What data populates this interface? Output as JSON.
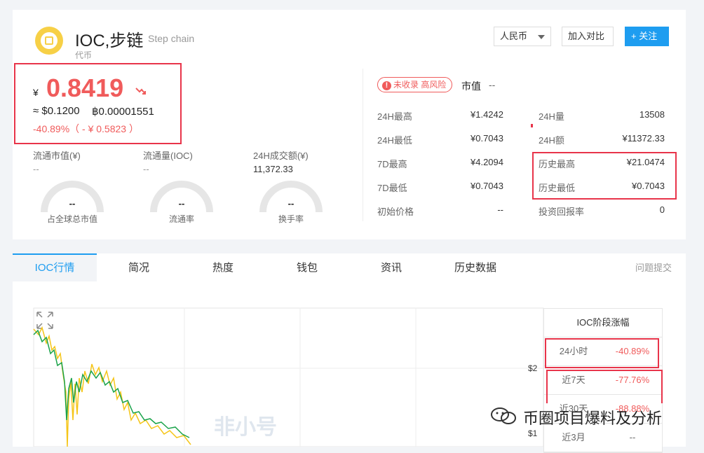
{
  "coin": {
    "name": "IOC,步链",
    "english_name": "Step chain",
    "type": "代币"
  },
  "header_buttons": {
    "currency": "人民币",
    "compare": "加入对比",
    "follow": "+ 关注"
  },
  "price": {
    "symbol": "¥",
    "value": "0.8419",
    "usd": "≈ $0.1200",
    "btc": "฿0.00001551",
    "change": "-40.89%（ - ¥ 0.5823 ）"
  },
  "stats": [
    {
      "label": "流通市值(¥)",
      "value": "--"
    },
    {
      "label": "流通量(IOC)",
      "value": "--"
    },
    {
      "label": "24H成交额(¥)",
      "value": "11,372.33"
    }
  ],
  "gauges": [
    {
      "value": "--",
      "label": "占全球总市值"
    },
    {
      "value": "--",
      "label": "流通率"
    },
    {
      "value": "--",
      "label": "换手率"
    }
  ],
  "risk_badge": "未收录 高风险",
  "market_cap": {
    "label": "市值",
    "value": "--"
  },
  "metrics_left": [
    {
      "label": "24H最高",
      "value": "¥1.4242"
    },
    {
      "label": "24H最低",
      "value": "¥0.7043"
    },
    {
      "label": "7D最高",
      "value": "¥4.2094"
    },
    {
      "label": "7D最低",
      "value": "¥0.7043"
    },
    {
      "label": "初始价格",
      "value": "--"
    }
  ],
  "metrics_right": [
    {
      "label": "24H量",
      "value": "13508"
    },
    {
      "label": "24H额",
      "value": "¥11372.33"
    },
    {
      "label": "历史最高",
      "value": "¥21.0474"
    },
    {
      "label": "历史最低",
      "value": "¥0.7043"
    },
    {
      "label": "投资回报率",
      "value": "0"
    }
  ],
  "tabs": [
    "IOC行情",
    "简况",
    "热度",
    "钱包",
    "资讯",
    "历史数据"
  ],
  "feedback": "问题提交",
  "stage_table": {
    "title": "IOC阶段涨幅",
    "rows": [
      {
        "period": "24小时",
        "change": "-40.89%"
      },
      {
        "period": "近7天",
        "change": "-77.76%"
      },
      {
        "period": "近30天",
        "change": "-88.88%"
      },
      {
        "period": "近3月",
        "change": "--"
      }
    ]
  },
  "chart_axis": {
    "y_high": "$2",
    "y_low": "$1"
  },
  "watermark": "非小号",
  "wechat_caption": "币圈项目爆料及分析",
  "colors": {
    "accent": "#1e9df0",
    "down": "#f05b5b",
    "series_a": "#f5c518",
    "series_b": "#1aa34a"
  }
}
